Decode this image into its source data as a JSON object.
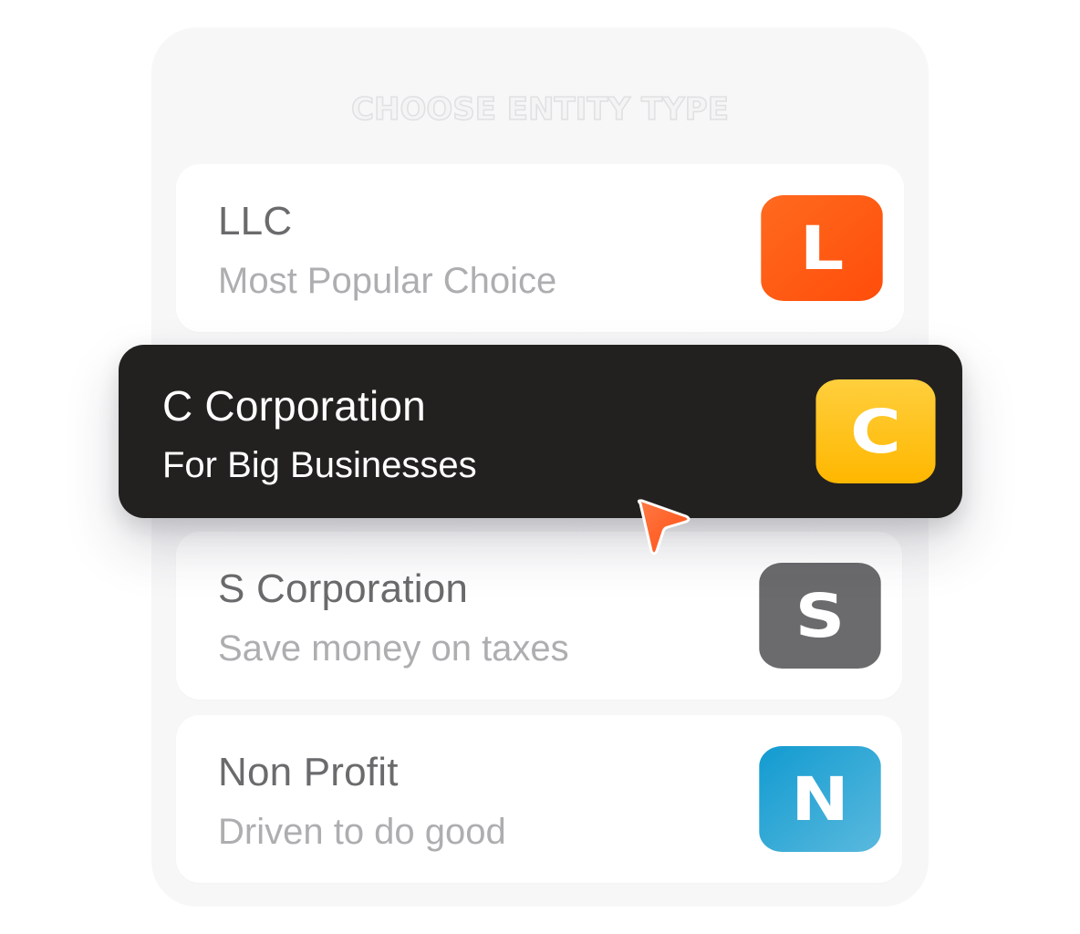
{
  "header": {
    "title": "CHOOSE ENTITY TYPE"
  },
  "options": [
    {
      "name": "LLC",
      "description": "Most Popular Choice",
      "badge_letter": "L",
      "badge_color": "#ff5514"
    },
    {
      "name": "C Corporation",
      "description": "For Big Businesses",
      "badge_letter": "C",
      "badge_color": "#ffc21a",
      "selected": true
    },
    {
      "name": "S Corporation",
      "description": "Save money on taxes",
      "badge_letter": "S",
      "badge_color": "#6b6b6d"
    },
    {
      "name": "Non Profit",
      "description": "Driven to do good",
      "badge_letter": "N",
      "badge_color": "#2aa6d6"
    }
  ],
  "cursor": {
    "icon": "pointer-arrow-icon",
    "color": "#ff5a1f"
  }
}
